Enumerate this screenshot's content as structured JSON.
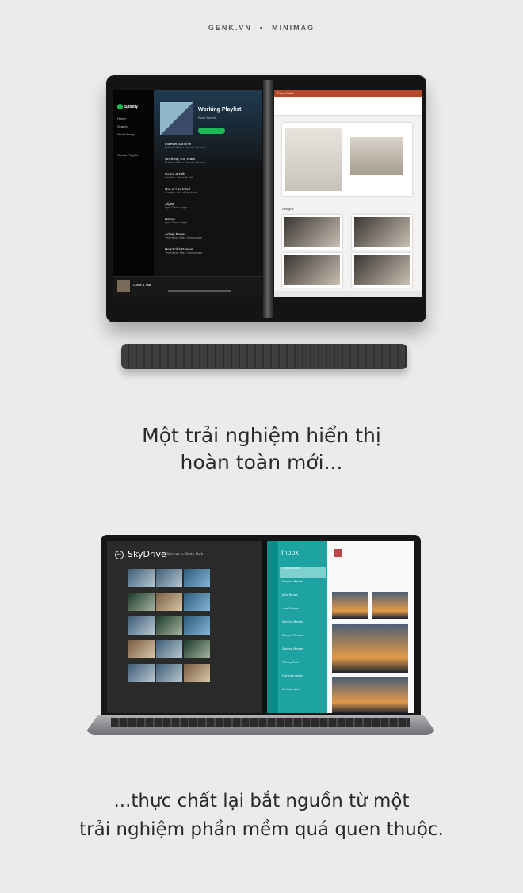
{
  "header": {
    "brand": "GENK.VN",
    "separator": "•",
    "section": "MINIMAG"
  },
  "device1": {
    "spotify": {
      "logo": "Spotify",
      "nav": [
        "Home",
        "Search",
        "Your Library"
      ],
      "create_playlist": "Create Playlist",
      "playlist_title": "Working Playlist",
      "playlist_by": "Rose Barrett",
      "play_label": "PLAY",
      "tracks": [
        {
          "title": "Forever Summer",
          "artist": "Broken Halos • Forever Summer",
          "time": "3:20"
        },
        {
          "title": "Anything You Want",
          "artist": "Broken Halos • Forever Summer",
          "time": "3:45"
        },
        {
          "title": "Come & Talk",
          "artist": "Coastle • Come & Talk",
          "time": "3:31"
        },
        {
          "title": "Out of Her Mind",
          "artist": "Coastle • Out of Her Mind",
          "time": "4:02"
        },
        {
          "title": "Alight",
          "artist": "Eyre Glen • Alight",
          "time": "3:11"
        },
        {
          "title": "Haven",
          "artist": "Eyre Glen • Alight",
          "time": "2:55"
        },
        {
          "title": "Achey Bones",
          "artist": "The Happy Fits • Concentrate",
          "time": "3:07"
        },
        {
          "title": "Heart of a Dancer",
          "artist": "The Happy Fits • Concentrate",
          "time": "3:24"
        }
      ],
      "now_playing": "Come & Talk"
    },
    "powerpoint": {
      "app_title": "PowerPoint",
      "section_label": "Designs"
    }
  },
  "caption1": {
    "line1": "Một trải nghiệm hiển thị",
    "line2": "hoàn toàn mới..."
  },
  "device2": {
    "skydrive": {
      "title": "SkyDrive",
      "breadcrumb": "Pictures > State Park",
      "photo_count": 15
    },
    "mail": {
      "folder": "Inbox",
      "items": [
        "Chris Jenkins",
        "Dorena Mercer",
        "Julia Rouse",
        "Lisa Getson",
        "Dorena Mercer",
        "Steven Thrash",
        "Dorena Mercer",
        "Tiffany Park",
        "Francine Potter",
        "Chris Jenkins"
      ]
    }
  },
  "caption2": {
    "line1": "...thực chất lại bắt nguồn từ một",
    "line2": "trải nghiệm phần mềm quá quen thuộc."
  }
}
